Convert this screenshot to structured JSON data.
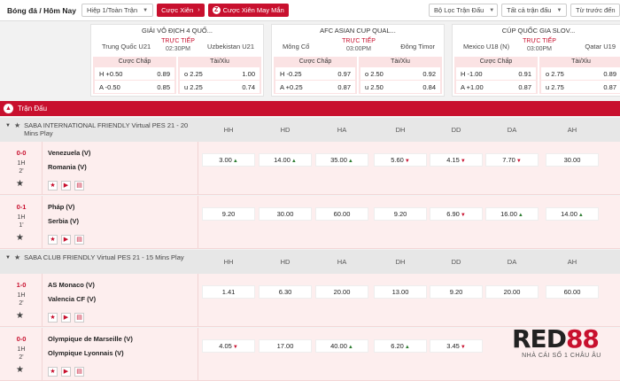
{
  "topbar": {
    "title": "Bóng đá / Hôm Nay",
    "period_select": "Hiệp 1/Toàn Trận",
    "parlay_button": "Cược Xiên",
    "lucky_parlay_button": "Cược Xiên May Mắn",
    "lucky_parlay_icon": "Z",
    "filter_select": "Bộ Lọc Trận Đấu",
    "tournament_select": "Tất cả trận đấu",
    "sort_select": "Từ trước đến"
  },
  "cards": [
    {
      "league": "GIẢI VÔ ĐỊCH 4 QUỐ...",
      "home": "Trung Quốc U21",
      "away": "Uzbekistan U21",
      "live": "TRỰC TIẾP",
      "time": "02:30PM",
      "handicap_header": "Cược Chấp",
      "ou_header": "Tài/Xỉu",
      "hdp": [
        {
          "label": "H +0.50",
          "odd": "0.89"
        },
        {
          "label": "A -0.50",
          "odd": "0.85"
        }
      ],
      "ou": [
        {
          "label": "o 2.25",
          "odd": "1.00"
        },
        {
          "label": "u 2.25",
          "odd": "0.74"
        }
      ]
    },
    {
      "league": "AFC ASIAN CUP QUAL...",
      "home": "Mông Cổ",
      "away": "Đông Timor",
      "live": "TRỰC TIẾP",
      "time": "03:00PM",
      "handicap_header": "Cược Chấp",
      "ou_header": "Tài/Xỉu",
      "hdp": [
        {
          "label": "H -0.25",
          "odd": "0.97"
        },
        {
          "label": "A +0.25",
          "odd": "0.87"
        }
      ],
      "ou": [
        {
          "label": "o 2.50",
          "odd": "0.92"
        },
        {
          "label": "u 2.50",
          "odd": "0.84"
        }
      ]
    },
    {
      "league": "CÚP QUỐC GIA SLOV...",
      "home": "Mexico U18 (N)",
      "away": "Qatar U19",
      "live": "TRỰC TIẾP",
      "time": "03:00PM",
      "handicap_header": "Cược Chấp",
      "ou_header": "Tài/Xỉu",
      "hdp": [
        {
          "label": "H -1.00",
          "odd": "0.91"
        },
        {
          "label": "A +1.00",
          "odd": "0.87"
        }
      ],
      "ou": [
        {
          "label": "o 2.75",
          "odd": "0.89"
        },
        {
          "label": "u 2.75",
          "odd": "0.87"
        }
      ]
    }
  ],
  "section": {
    "title": "Trận Đấu"
  },
  "columns": [
    "HH",
    "HD",
    "HA",
    "DH",
    "DD",
    "DA",
    "AH"
  ],
  "leagues": [
    {
      "name": "SABA INTERNATIONAL FRIENDLY Virtual PES 21 - 20 Mins Play",
      "matches": [
        {
          "score": "0-0",
          "half": "1H",
          "minute": "2'",
          "home": "Venezuela (V)",
          "away": "Romania (V)",
          "odds": [
            {
              "v": "3.00",
              "t": "up"
            },
            {
              "v": "14.00",
              "t": "up"
            },
            {
              "v": "35.00",
              "t": "up"
            },
            {
              "v": "5.60",
              "t": "dn"
            },
            {
              "v": "4.15",
              "t": "dn"
            },
            {
              "v": "7.70",
              "t": "dn"
            },
            {
              "v": "30.00",
              "t": ""
            }
          ]
        },
        {
          "score": "0-1",
          "half": "1H",
          "minute": "1'",
          "home": "Pháp (V)",
          "away": "Serbia (V)",
          "odds": [
            {
              "v": "9.20",
              "t": ""
            },
            {
              "v": "30.00",
              "t": ""
            },
            {
              "v": "60.00",
              "t": ""
            },
            {
              "v": "9.20",
              "t": ""
            },
            {
              "v": "6.90",
              "t": "dn"
            },
            {
              "v": "16.00",
              "t": "up"
            },
            {
              "v": "14.00",
              "t": "up"
            }
          ]
        }
      ]
    },
    {
      "name": "SABA CLUB FRIENDLY Virtual PES 21 - 15 Mins Play",
      "matches": [
        {
          "score": "1-0",
          "half": "1H",
          "minute": "2'",
          "home": "AS Monaco (V)",
          "away": "Valencia CF (V)",
          "odds": [
            {
              "v": "1.41",
              "t": ""
            },
            {
              "v": "6.30",
              "t": ""
            },
            {
              "v": "20.00",
              "t": ""
            },
            {
              "v": "13.00",
              "t": ""
            },
            {
              "v": "9.20",
              "t": ""
            },
            {
              "v": "20.00",
              "t": ""
            },
            {
              "v": "60.00",
              "t": ""
            }
          ]
        },
        {
          "score": "0-0",
          "half": "1H",
          "minute": "2'",
          "home": "Olympique de Marseille (V)",
          "away": "Olympique Lyonnais (V)",
          "odds": [
            {
              "v": "4.05",
              "t": "dn"
            },
            {
              "v": "17.00",
              "t": ""
            },
            {
              "v": "40.00",
              "t": "up"
            },
            {
              "v": "6.20",
              "t": "up"
            },
            {
              "v": "3.45",
              "t": "dn"
            },
            {
              "v": "",
              "t": ""
            },
            {
              "v": "",
              "t": ""
            }
          ]
        }
      ]
    }
  ],
  "logo": {
    "text_a": "RED",
    "text_b": "88",
    "tagline": "NHÀ CÁI SỐ 1 CHÂU ÂU"
  }
}
